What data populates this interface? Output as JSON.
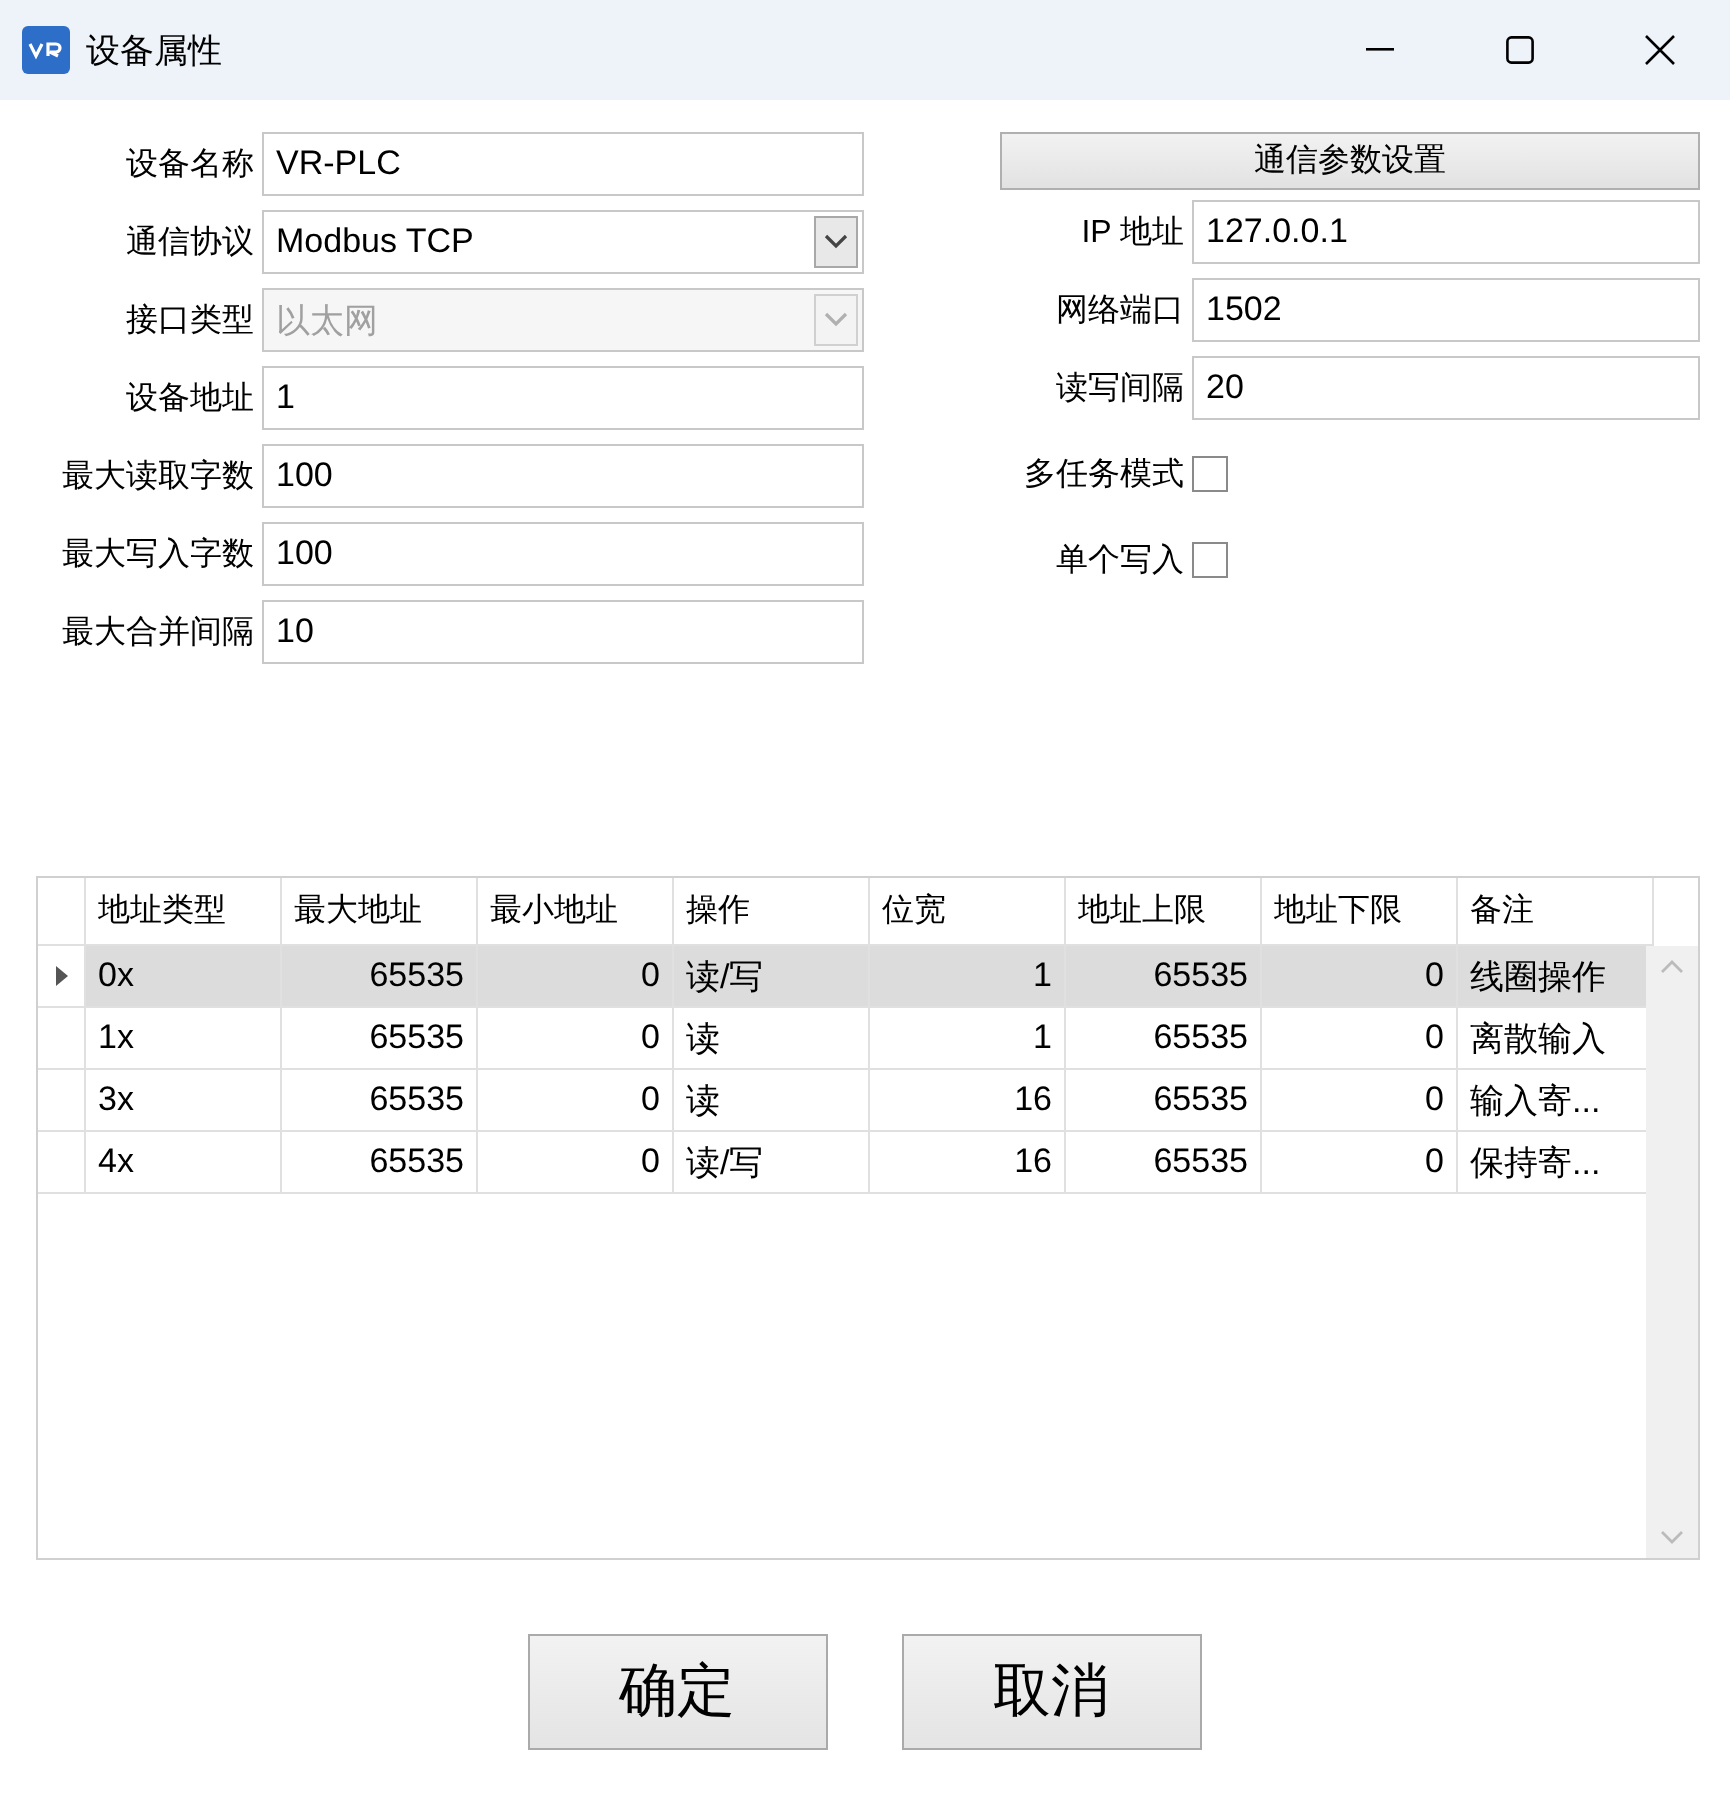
{
  "window": {
    "title": "设备属性"
  },
  "left_fields": [
    {
      "label": "设备名称",
      "kind": "text",
      "value": "VR-PLC",
      "disabled": false
    },
    {
      "label": "通信协议",
      "kind": "combo",
      "value": "Modbus TCP",
      "disabled": false
    },
    {
      "label": "接口类型",
      "kind": "combo",
      "value": "以太网",
      "disabled": true
    },
    {
      "label": "设备地址",
      "kind": "text",
      "value": "1",
      "disabled": false
    },
    {
      "label": "最大读取字数",
      "kind": "text",
      "value": "100",
      "disabled": false
    },
    {
      "label": "最大写入字数",
      "kind": "text",
      "value": "100",
      "disabled": false
    },
    {
      "label": "最大合并间隔",
      "kind": "text",
      "value": "10",
      "disabled": false
    }
  ],
  "comm_button": "通信参数设置",
  "right_fields": [
    {
      "label": "IP 地址",
      "value": "127.0.0.1"
    },
    {
      "label": "网络端口",
      "value": "1502"
    },
    {
      "label": "读写间隔",
      "value": "20"
    }
  ],
  "checkboxes": [
    {
      "label": "多任务模式",
      "checked": false
    },
    {
      "label": "单个写入",
      "checked": false
    }
  ],
  "table": {
    "columns": [
      "地址类型",
      "最大地址",
      "最小地址",
      "操作",
      "位宽",
      "地址上限",
      "地址下限",
      "备注"
    ],
    "rows": [
      {
        "selected": true,
        "cells": [
          "0x",
          "65535",
          "0",
          "读/写",
          "1",
          "65535",
          "0",
          "线圈操作"
        ]
      },
      {
        "selected": false,
        "cells": [
          "1x",
          "65535",
          "0",
          "读",
          "1",
          "65535",
          "0",
          "离散输入"
        ]
      },
      {
        "selected": false,
        "cells": [
          "3x",
          "65535",
          "0",
          "读",
          "16",
          "65535",
          "0",
          "输入寄..."
        ]
      },
      {
        "selected": false,
        "cells": [
          "4x",
          "65535",
          "0",
          "读/写",
          "16",
          "65535",
          "0",
          "保持寄..."
        ]
      }
    ]
  },
  "buttons": [
    "确定",
    "取消"
  ]
}
